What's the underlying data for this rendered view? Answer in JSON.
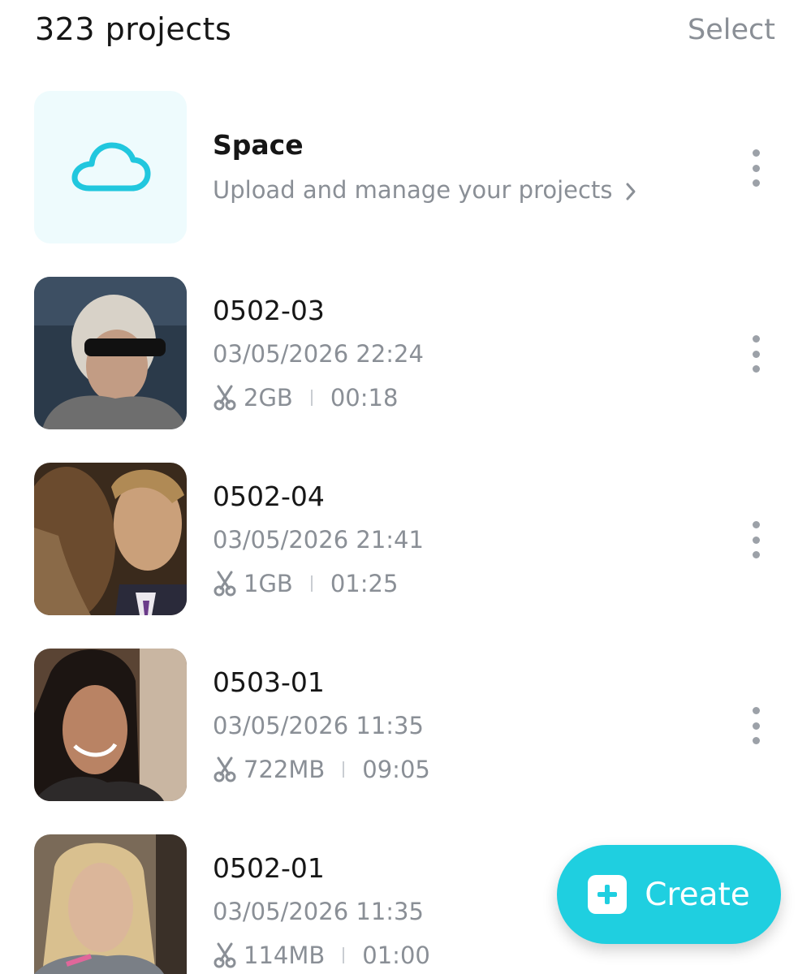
{
  "header": {
    "project_count": "323 projects",
    "select_label": "Select"
  },
  "space": {
    "title": "Space",
    "subtitle": "Upload and manage your projects",
    "icon": "cloud-icon",
    "accent": "#21c7de"
  },
  "projects": [
    {
      "name": "0502-03",
      "date": "03/05/2026 22:24",
      "size": "2GB",
      "duration": "00:18",
      "thumb_colors": [
        "#2b3a4a",
        "#b8b0a5",
        "#1a1a1a"
      ]
    },
    {
      "name": "0502-04",
      "date": "03/05/2026 21:41",
      "size": "1GB",
      "duration": "01:25",
      "thumb_colors": [
        "#5a3e28",
        "#c9a27e",
        "#2d2318"
      ]
    },
    {
      "name": "0503-01",
      "date": "03/05/2026 11:35",
      "size": "722MB",
      "duration": "09:05",
      "thumb_colors": [
        "#3a2a22",
        "#b98a6a",
        "#6b5a4a"
      ]
    },
    {
      "name": "0502-01",
      "date": "03/05/2026 11:35",
      "size": "114MB",
      "duration": "01:00",
      "thumb_colors": [
        "#6a5e50",
        "#d6b89a",
        "#9a8c7c"
      ]
    }
  ],
  "create_button": {
    "label": "Create",
    "icon": "plus-square-icon",
    "color": "#1fcfe0"
  }
}
